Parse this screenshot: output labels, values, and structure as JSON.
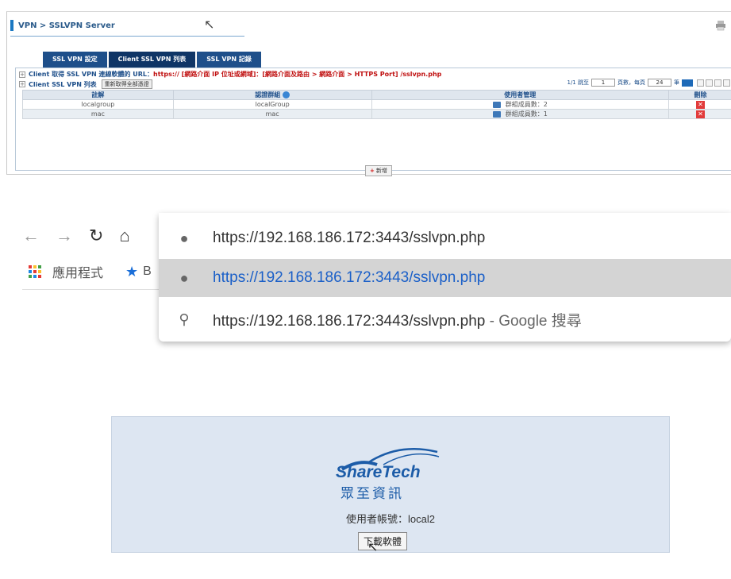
{
  "admin": {
    "breadcrumb": "VPN > SSLVPN Server",
    "tabs": [
      "SSL VPN 設定",
      "Client SSL VPN 列表",
      "SSL VPN 記錄"
    ],
    "info_label": "Client 取得 SSL VPN 連線軟體的 URL：",
    "info_url": "https:// [網路介面 IP 位址或網域]：[網路介面及路由 > 網路介面 > HTTPS Port] /sslvpn.php",
    "list_label": "Client SSL VPN 列表",
    "clear_button": "重新取得全部憑證",
    "pager": {
      "page_count": "1/1",
      "jump_label": "跳至",
      "page_value": "1",
      "per_page_label": "頁數，每頁",
      "per_page_value": "24",
      "unit": "筆"
    },
    "columns": [
      "註解",
      "認證群組",
      "使用者管理",
      "刪除"
    ],
    "rows": [
      {
        "note": "localgroup",
        "group": "localGroup",
        "members": "群組成員數：2"
      },
      {
        "note": "mac",
        "group": "mac",
        "members": "群組成員數：1"
      }
    ],
    "add_button": "新增",
    "colors": {
      "tab": "#1e4f8a",
      "url_red": "#c01010",
      "delete": "#e23b3b"
    }
  },
  "browser": {
    "nav_icons": [
      "back-icon",
      "forward-icon",
      "reload-icon",
      "home-icon"
    ],
    "bookmark_apps": "應用程式",
    "bookmark_b": "B",
    "omnibox_text": "https://192.168.186.172:3443/sslvpn.php",
    "suggestions": [
      {
        "icon": "globe-icon",
        "text": "https://192.168.186.172:3443/sslvpn.php"
      },
      {
        "icon": "search-icon",
        "text": "https://192.168.186.172:3443/sslvpn.php",
        "suffix": " - Google 搜尋"
      }
    ]
  },
  "login": {
    "logo_text": "ShareTech",
    "logo_cn": "眾至資訊",
    "user_line": "使用者帳號：local2",
    "download_button": "下載軟體"
  }
}
